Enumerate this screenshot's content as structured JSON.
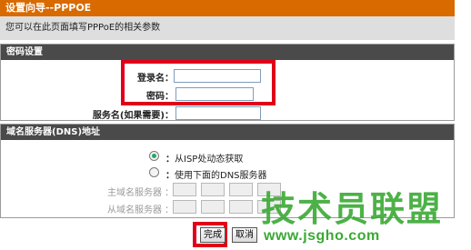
{
  "wizard": {
    "title": "设置向导--PPPOE",
    "description": "您可以在此页面填写PPPoE的相关参数"
  },
  "password_section": {
    "header": "密码设置",
    "username_label": "登录名",
    "password_label": "密码",
    "service_label": "服务名(如果需要)",
    "colon": "："
  },
  "dns_section": {
    "header": "域名服务器(DNS)地址",
    "option_auto": "从ISP处动态获取",
    "option_manual": "使用下面的DNS服务器",
    "colon": "：",
    "primary_label": "主域名服务器",
    "secondary_label": "从域名服务器",
    "selected": "auto"
  },
  "buttons": {
    "finish": "完成",
    "cancel": "取消"
  },
  "watermark": {
    "text": "技术员联盟",
    "url": "www.jsgho.com"
  },
  "colors": {
    "title_bar": "#d86a00",
    "section_header": "#4a4a4a",
    "highlight_frame": "#e1001a",
    "watermark": "#3aa935"
  }
}
